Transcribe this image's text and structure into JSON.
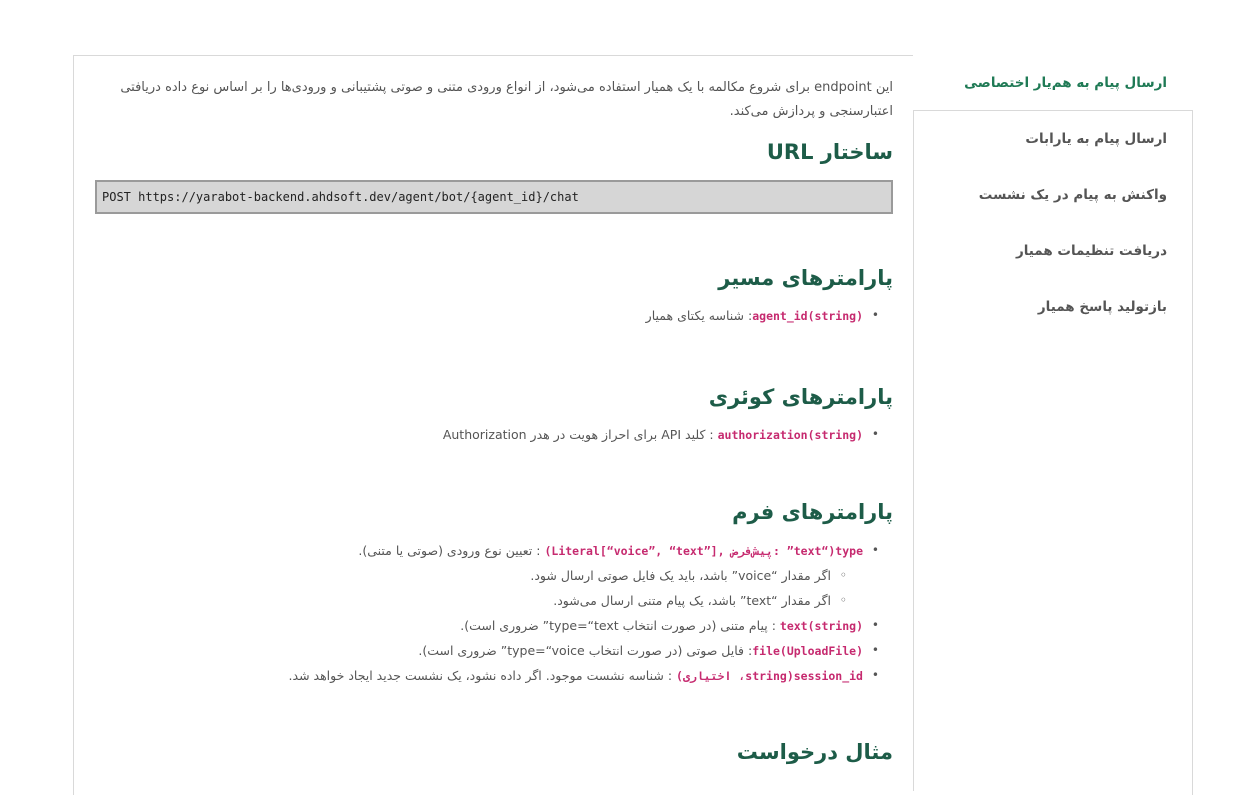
{
  "tabs": [
    {
      "label": "ارسال پیام به هم‌یار اختصاصی",
      "active": true
    },
    {
      "label": "ارسال پیام به یارابات",
      "active": false
    },
    {
      "label": "واکنش به پیام در یک نشست",
      "active": false
    },
    {
      "label": "دریافت تنظیمات همیار",
      "active": false
    },
    {
      "label": "بازتولید پاسخ همیار",
      "active": false
    }
  ],
  "content": {
    "intro": "این endpoint برای شروع مکالمه با یک همیار استفاده می‌شود، از انواع ورودی متنی و صوتی پشتیبانی و ورودی‌ها را بر اساس نوع داده دریافتی اعتبارسنجی و پردازش می‌کند.",
    "url_heading": "ساختار URL",
    "url": "POST https://yarabot-backend.ahdsoft.dev/agent/bot/{agent_id}/chat",
    "path_heading": "پارامترهای مسیر",
    "path_params": [
      {
        "code": "agent_id(string)",
        "text": ": شناسه یکتای همیار"
      }
    ],
    "query_heading": "پارامترهای کوئری",
    "query_params": [
      {
        "code": "authorization(string)",
        "text": " : کلید API برای احراز هویت در هدر Authorization"
      }
    ],
    "form_heading": "پارامترهای فرم",
    "form_params": [
      {
        "code": "type(“text” :پیش‌فرض ,[”Literal[“voice”, “text)",
        "text": " : تعیین نوع ورودی (صوتی یا متنی).",
        "sub": false
      },
      {
        "code": "",
        "text": "اگر مقدار “voice” باشد، باید یک فایل صوتی ارسال شود.",
        "sub": true
      },
      {
        "code": "",
        "text": "اگر مقدار “text” باشد، یک پیام متنی ارسال می‌شود.",
        "sub": true
      },
      {
        "code": "text(string)",
        "text": " : پیام متنی (در صورت انتخاب type=“text” ضروری است).",
        "sub": false
      },
      {
        "code": "file(UploadFile)",
        "text": ": فایل صوتی (در صورت انتخاب type=“voice” ضروری است).",
        "sub": false
      },
      {
        "code": "session_id(string، اختیاری)",
        "text": " : شناسه نشست موجود. اگر داده نشود، یک نشست جدید ایجاد خواهد شد.",
        "sub": false
      }
    ],
    "example_heading": "مثال درخواست"
  },
  "colors": {
    "accent": "#1f7a55",
    "heading": "#1d5c48",
    "code": "#c62a6f"
  }
}
